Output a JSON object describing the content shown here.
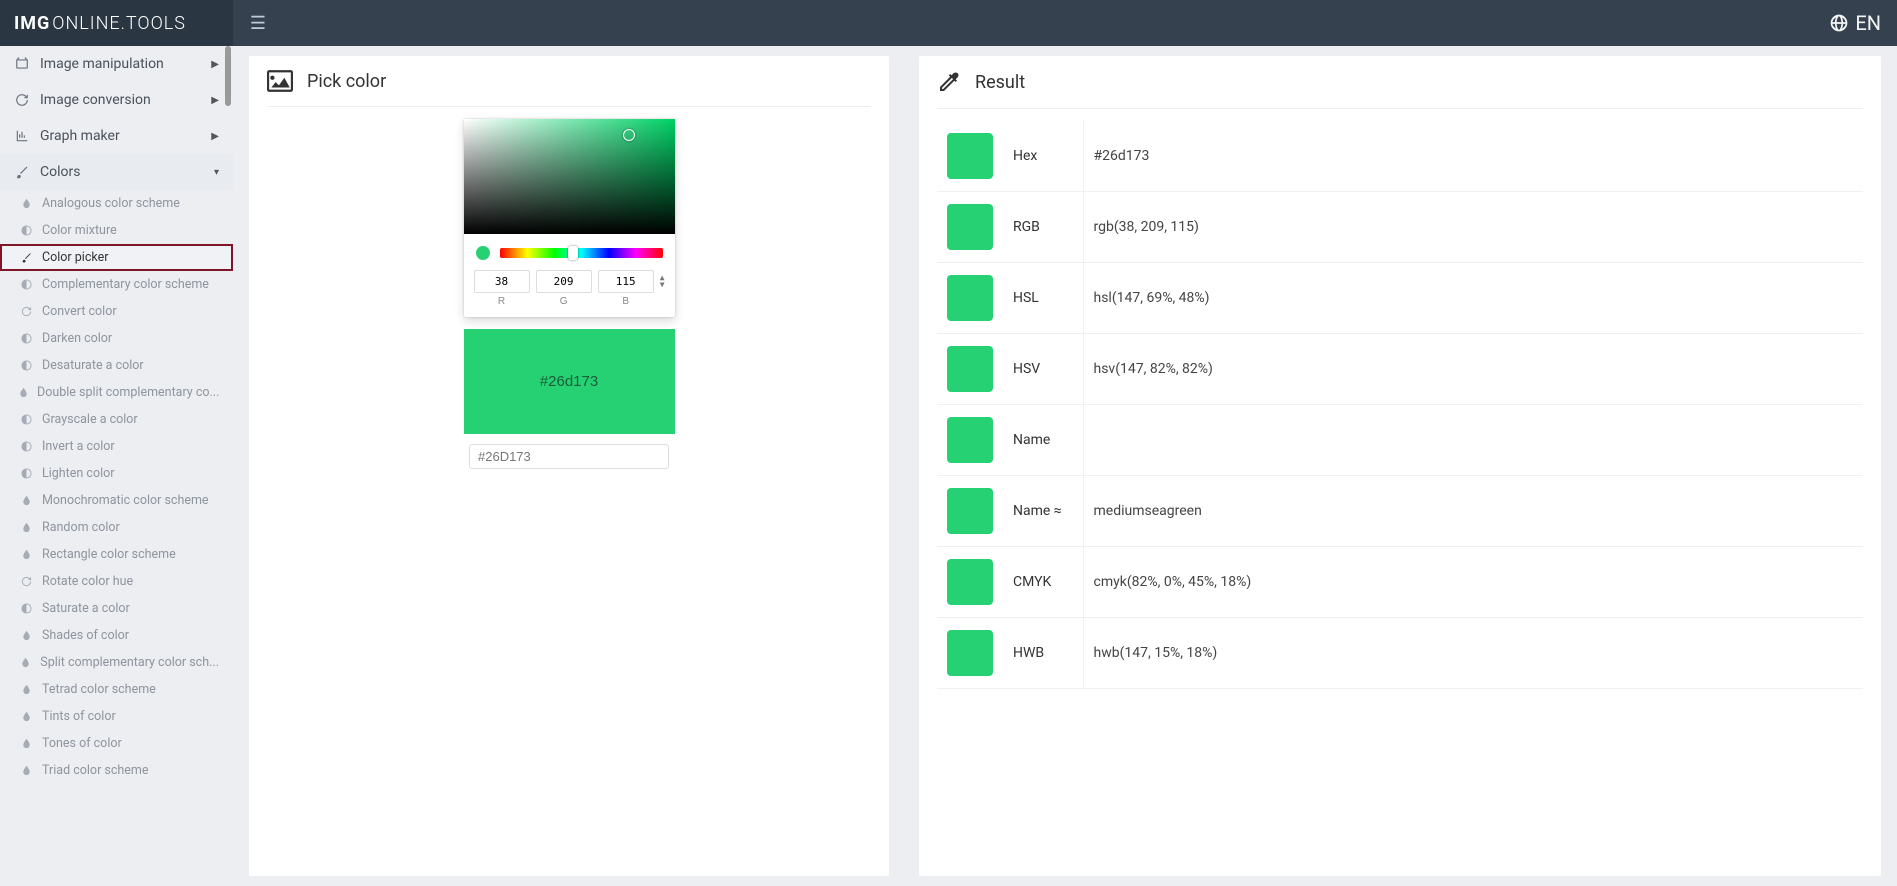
{
  "brand": {
    "bold": "IMG",
    "rest": "ONLINE.TOOLS"
  },
  "language": "EN",
  "nav": [
    {
      "label": "Image manipulation"
    },
    {
      "label": "Image conversion"
    },
    {
      "label": "Graph maker"
    },
    {
      "label": "Colors"
    }
  ],
  "colorSub": [
    "Analogous color scheme",
    "Color mixture",
    "Color picker",
    "Complementary color scheme",
    "Convert color",
    "Darken color",
    "Desaturate a color",
    "Double split complementary co...",
    "Grayscale a color",
    "Invert a color",
    "Lighten color",
    "Monochromatic color scheme",
    "Random color",
    "Rectangle color scheme",
    "Rotate color hue",
    "Saturate a color",
    "Shades of color",
    "Split complementary color sch...",
    "Tetrad color scheme",
    "Tints of color",
    "Tones of color",
    "Triad color scheme"
  ],
  "activeSubIndex": 2,
  "pick": {
    "title": "Pick color",
    "hexSwatch": "#26d173",
    "hexInput": "#26D173",
    "r": "38",
    "g": "209",
    "b": "115",
    "rLabel": "R",
    "gLabel": "G",
    "bLabel": "B",
    "swatchColor": "#26d173"
  },
  "result": {
    "title": "Result",
    "rows": [
      {
        "label": "Hex",
        "value": "#26d173"
      },
      {
        "label": "RGB",
        "value": "rgb(38, 209, 115)"
      },
      {
        "label": "HSL",
        "value": "hsl(147, 69%, 48%)"
      },
      {
        "label": "HSV",
        "value": "hsv(147, 82%, 82%)"
      },
      {
        "label": "Name",
        "value": ""
      },
      {
        "label": "Name ≈",
        "value": "mediumseagreen"
      },
      {
        "label": "CMYK",
        "value": "cmyk(82%, 0%, 45%, 18%)"
      },
      {
        "label": "HWB",
        "value": "hwb(147, 15%, 18%)"
      }
    ]
  },
  "subIcons": [
    "drop",
    "half",
    "brush",
    "half",
    "refresh",
    "half",
    "half",
    "drop",
    "half",
    "half",
    "half",
    "drop",
    "drop",
    "drop",
    "refresh",
    "half",
    "drop",
    "drop",
    "drop",
    "drop",
    "drop",
    "drop"
  ]
}
